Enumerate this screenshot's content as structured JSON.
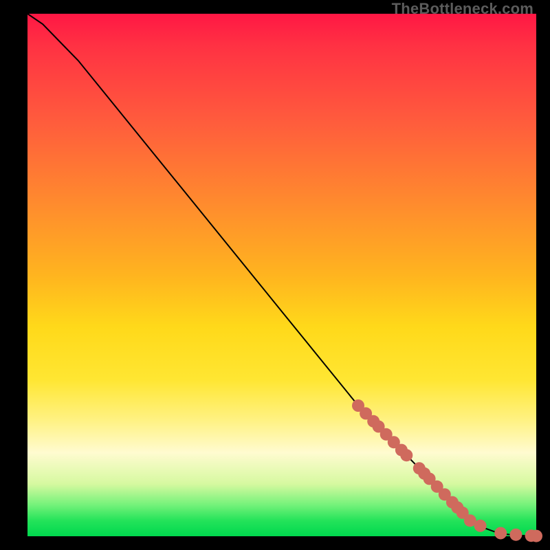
{
  "watermark": {
    "text": "TheBottleneck.com"
  },
  "colors": {
    "curve": "#000000",
    "marker_fill": "#cf6a5d",
    "marker_stroke": "#9c4a40"
  },
  "chart_data": {
    "type": "line",
    "title": "",
    "xlabel": "",
    "ylabel": "",
    "xlim": [
      0,
      100
    ],
    "ylim": [
      0,
      100
    ],
    "grid": false,
    "series": [
      {
        "name": "curve",
        "x": [
          0,
          3,
          6,
          10,
          15,
          20,
          25,
          30,
          35,
          40,
          45,
          50,
          55,
          60,
          65,
          70,
          75,
          78,
          81,
          84,
          86,
          88,
          90,
          92,
          94,
          96,
          98,
          100
        ],
        "y": [
          100,
          98,
          95,
          91,
          85,
          79,
          73,
          67,
          61,
          55,
          49,
          43,
          37,
          31,
          25,
          20,
          15,
          12,
          9,
          6,
          4,
          2.5,
          1.5,
          0.8,
          0.4,
          0.2,
          0.1,
          0.05
        ]
      }
    ],
    "markers": [
      {
        "x": 65,
        "y": 25
      },
      {
        "x": 66.5,
        "y": 23.5
      },
      {
        "x": 68,
        "y": 22
      },
      {
        "x": 69,
        "y": 21
      },
      {
        "x": 70.5,
        "y": 19.5
      },
      {
        "x": 72,
        "y": 18
      },
      {
        "x": 73.5,
        "y": 16.5
      },
      {
        "x": 74.5,
        "y": 15.5
      },
      {
        "x": 77,
        "y": 13
      },
      {
        "x": 78,
        "y": 12
      },
      {
        "x": 79,
        "y": 11
      },
      {
        "x": 80.5,
        "y": 9.5
      },
      {
        "x": 82,
        "y": 8
      },
      {
        "x": 83.5,
        "y": 6.5
      },
      {
        "x": 84.5,
        "y": 5.5
      },
      {
        "x": 85.5,
        "y": 4.5
      },
      {
        "x": 87,
        "y": 3
      },
      {
        "x": 89,
        "y": 2
      },
      {
        "x": 93,
        "y": 0.6
      },
      {
        "x": 96,
        "y": 0.3
      },
      {
        "x": 99,
        "y": 0.1
      },
      {
        "x": 100,
        "y": 0.05
      }
    ]
  }
}
